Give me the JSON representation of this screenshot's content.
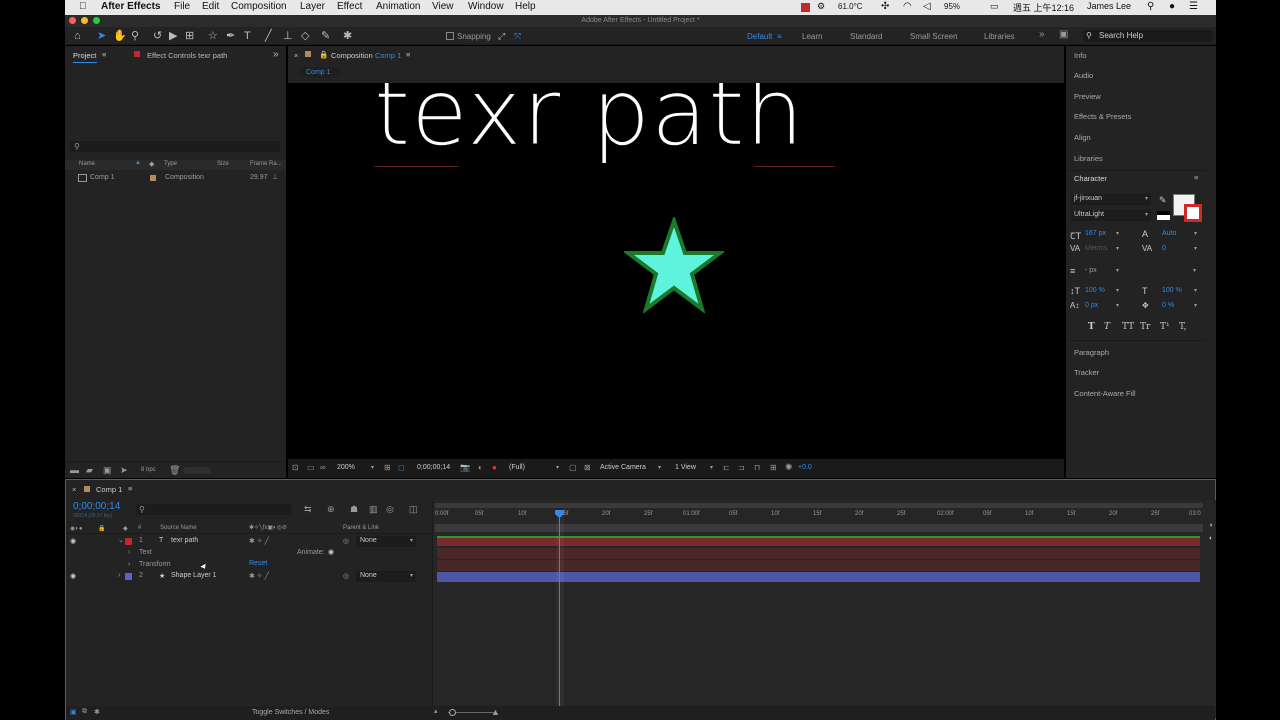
{
  "menubar": {
    "app": "After Effects",
    "items": [
      "File",
      "Edit",
      "Composition",
      "Layer",
      "Effect",
      "Animation",
      "View",
      "Window",
      "Help"
    ],
    "temp": "61.0°C",
    "battery": "95%",
    "clock": "週五 上午12:16",
    "user": "James Lee"
  },
  "title": "Adobe After Effects - Untitled Project *",
  "toolbar": {
    "snapping": "Snapping",
    "workspaces": [
      "Default",
      "Learn",
      "Standard",
      "Small Screen",
      "Libraries"
    ],
    "search": "Search Help"
  },
  "project": {
    "tab": "Project",
    "effect_controls": "Effect Controls texr path",
    "search_placeholder": "⚲",
    "cols": [
      "Name",
      "Type",
      "Size",
      "Frame Ra..."
    ],
    "item": {
      "name": "Comp 1",
      "type": "Composition",
      "fps": "29.97"
    },
    "bpc": "8 bpc"
  },
  "viewer": {
    "tab_prefix": "Composition",
    "tab_name": "Comp 1",
    "subtab": "Comp 1",
    "text": "texr path",
    "zoom": "200%",
    "timecode": "0;00;00;14",
    "resolution": "(Full)",
    "camera": "Active Camera",
    "view": "1 View",
    "exposure": "+0.0"
  },
  "right_panels": [
    "Info",
    "Audio",
    "Preview",
    "Effects & Presets",
    "Align",
    "Libraries"
  ],
  "character": {
    "title": "Character",
    "font": "jf-jinxuan",
    "style": "UltraLight",
    "size": "167 px",
    "leading": "Auto",
    "kerning": "Metrics",
    "tracking": "0",
    "stroke": "- px",
    "vscale": "100 %",
    "hscale": "100 %",
    "baseline": "0 px",
    "tsume": "0 %",
    "styles": [
      "T",
      "T",
      "TT",
      "Tr",
      "T¹",
      "T,"
    ]
  },
  "right_panels2": [
    "Paragraph",
    "Tracker",
    "Content-Aware Fill"
  ],
  "timeline": {
    "tab": "Comp 1",
    "timecode": "0;00;00;14",
    "fps_line": "00014 (29.97 fps)",
    "cols": {
      "source": "Source Name",
      "parent": "Parent & Link",
      "num": "#"
    },
    "ticks": [
      "0:00f",
      "05f",
      "10f",
      "15f",
      "20f",
      "25f",
      "01:00f",
      "05f",
      "10f",
      "15f",
      "20f",
      "25f",
      "02:00f",
      "05f",
      "10f",
      "15f",
      "20f",
      "25f",
      "03:0"
    ],
    "layers": [
      {
        "num": "1",
        "name": "texr path",
        "parent": "None"
      },
      {
        "num": "2",
        "name": "Shape Layer 1",
        "parent": "None"
      }
    ],
    "text_prop": "Text",
    "animate": "Animate:",
    "transform": "Transform",
    "reset": "Reset",
    "toggle": "Toggle Switches / Modes"
  }
}
